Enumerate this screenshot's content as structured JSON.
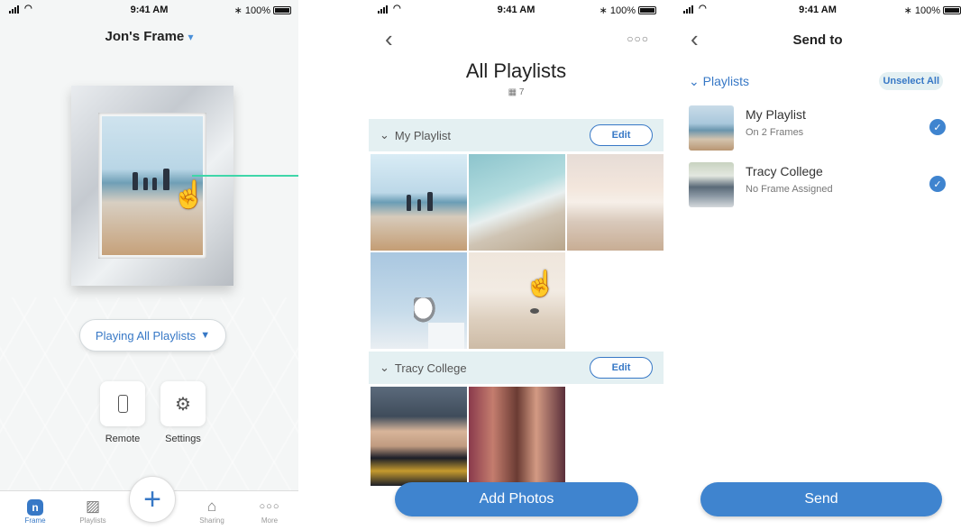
{
  "status": {
    "time": "9:41 AM",
    "battery": "100%"
  },
  "frame_screen": {
    "title": "Jon's Frame",
    "title_chevron": "▾",
    "playing_label": "Playing All Playlists",
    "playing_arrow": "▼",
    "remote_label": "Remote",
    "settings_label": "Settings",
    "tabs": [
      {
        "label": "Frame",
        "icon": "frame-logo-icon"
      },
      {
        "label": "Playlists",
        "icon": "photos-icon"
      },
      {
        "label": "Sharing",
        "icon": "gift-icon"
      },
      {
        "label": "More",
        "icon": "more-dots-icon"
      }
    ],
    "add_symbol": "+"
  },
  "playlists_screen": {
    "title": "All Playlists",
    "count": "7",
    "sections": [
      {
        "name": "My Playlist",
        "edit_label": "Edit"
      },
      {
        "name": "Tracy College",
        "edit_label": "Edit"
      }
    ],
    "add_photos_label": "Add Photos",
    "accent_color": "#3f84cf"
  },
  "send_screen": {
    "title": "Send to",
    "section_label": "Playlists",
    "unselect_label": "Unselect All",
    "items": [
      {
        "name": "My Playlist",
        "subtitle": "On 2 Frames",
        "selected": true
      },
      {
        "name": "Tracy College",
        "subtitle": "No Frame Assigned",
        "selected": true
      }
    ],
    "send_label": "Send"
  }
}
